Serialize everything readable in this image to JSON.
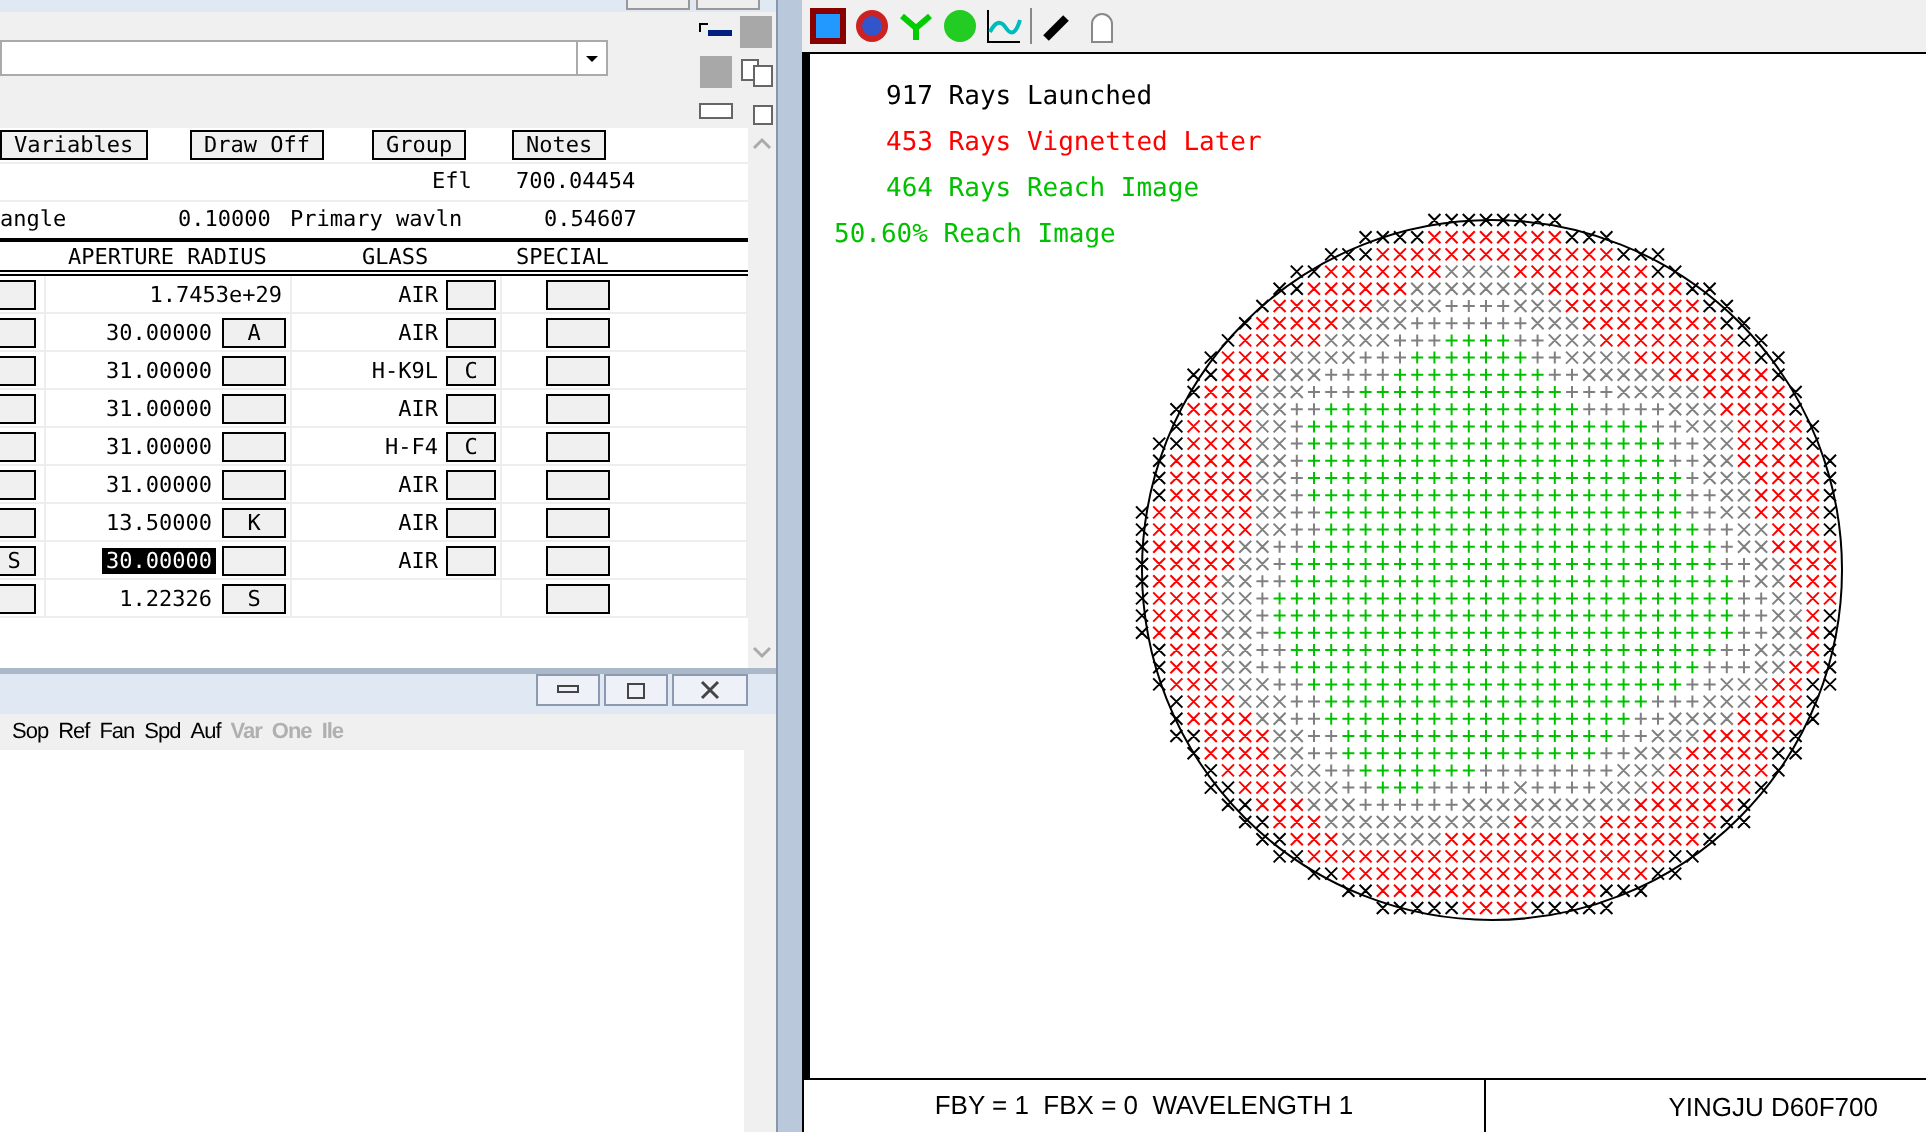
{
  "editor": {
    "buttons": [
      "Variables",
      "Draw Off",
      "Group",
      "Notes"
    ],
    "efl_label": "Efl",
    "efl_value": "700.04454",
    "angle_label": "angle",
    "angle_value": "0.10000",
    "wavln_label": "Primary wavln",
    "wavln_value": "0.54607",
    "columns": [
      "APERTURE RADIUS",
      "GLASS",
      "SPECIAL"
    ],
    "rows": [
      {
        "stub": "",
        "radius": "1.7453e+29",
        "radius_flag": null,
        "glass": "AIR",
        "glass_flag": "",
        "selected": false
      },
      {
        "stub": "",
        "radius": "30.00000",
        "radius_flag": "A",
        "glass": "AIR",
        "glass_flag": "",
        "selected": false
      },
      {
        "stub": "",
        "radius": "31.00000",
        "radius_flag": "",
        "glass": "H-K9L",
        "glass_flag": "C",
        "selected": false
      },
      {
        "stub": "",
        "radius": "31.00000",
        "radius_flag": "",
        "glass": "AIR",
        "glass_flag": "",
        "selected": false
      },
      {
        "stub": "",
        "radius": "31.00000",
        "radius_flag": "",
        "glass": "H-F4",
        "glass_flag": "C",
        "selected": false
      },
      {
        "stub": "",
        "radius": "31.00000",
        "radius_flag": "",
        "glass": "AIR",
        "glass_flag": "",
        "selected": false
      },
      {
        "stub": "",
        "radius": "13.50000",
        "radius_flag": "K",
        "glass": "AIR",
        "glass_flag": "",
        "selected": false
      },
      {
        "stub": "S",
        "radius": "30.00000",
        "radius_flag": "",
        "glass": "AIR",
        "glass_flag": "",
        "selected": true
      },
      {
        "stub": "",
        "radius": "1.22326",
        "radius_flag": "S",
        "glass": null,
        "glass_flag": null,
        "selected": false
      }
    ]
  },
  "lower_window": {
    "menu": [
      {
        "label": "Sop",
        "disabled": false
      },
      {
        "label": "Ref",
        "disabled": false
      },
      {
        "label": "Fan",
        "disabled": false
      },
      {
        "label": "Spd",
        "disabled": false
      },
      {
        "label": "Auf",
        "disabled": false
      },
      {
        "label": "Var",
        "disabled": true
      },
      {
        "label": "One",
        "disabled": true
      },
      {
        "label": "Ile",
        "disabled": true
      }
    ]
  },
  "plot": {
    "stats": [
      {
        "text": "917 Rays Launched",
        "color": "#000000",
        "indent": true
      },
      {
        "text": "453 Rays Vignetted Later",
        "color": "#ff0000",
        "indent": true
      },
      {
        "text": "464 Rays Reach Image",
        "color": "#00c000",
        "indent": true
      },
      {
        "text": "50.60% Reach Image",
        "color": "#00c000",
        "indent": false
      }
    ],
    "footer_left": "FBY = 1  FBX = 0  WAVELENGTH 1",
    "footer_right": "YINGJU D60F700"
  }
}
